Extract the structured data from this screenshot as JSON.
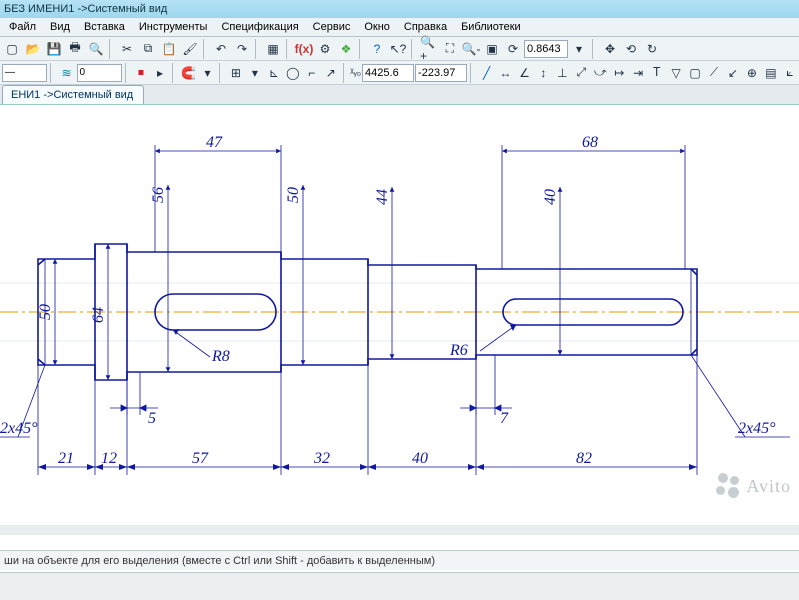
{
  "window": {
    "title": "БЕЗ ИМЕНИ1 ->Системный вид"
  },
  "menu": {
    "file": "Файл",
    "view": "Вид",
    "insert": "Вставка",
    "tools": "Инструменты",
    "spec": "Спецификация",
    "service": "Сервис",
    "window": "Окно",
    "help": "Справка",
    "libs": "Библиотеки"
  },
  "toolbar1": {
    "zoom_value": "0.8643",
    "btns": [
      "new",
      "open",
      "save",
      "print",
      "preview",
      "cut",
      "copy",
      "paste",
      "undo",
      "redo",
      "props",
      "fx",
      "vars",
      "layers",
      "sep",
      "help",
      "whats",
      "sep",
      "zoom-in",
      "zoom-area",
      "zoom-out",
      "zoom-fit",
      "zoom-prev"
    ]
  },
  "toolbar2": {
    "layer_value": "0",
    "coord_x": "4425.6",
    "coord_y": "-223.97"
  },
  "tabs": {
    "active": "ЕНИ1 ->Системный вид"
  },
  "status": {
    "hint": "ши на объекте для его выделения (вместе с Ctrl или Shift - добавить к выделенным)"
  },
  "watermark": {
    "text": "Avito"
  },
  "drawing": {
    "dims_top": {
      "d47": "47",
      "d68": "68"
    },
    "dims_upper": {
      "d56": "56",
      "d50": "50",
      "d44": "44",
      "d40": "40"
    },
    "dims_height": {
      "h50": "50",
      "h64": "64"
    },
    "radii": {
      "r8": "R8",
      "r6": "R6"
    },
    "dims_small": {
      "d5": "5",
      "d7": "7"
    },
    "chamfers": {
      "left": "2x45°",
      "right": "2x45°"
    },
    "dims_bottom": {
      "d21": "21",
      "d12": "12",
      "d57": "57",
      "d32": "32",
      "d40": "40",
      "d82": "82"
    }
  }
}
